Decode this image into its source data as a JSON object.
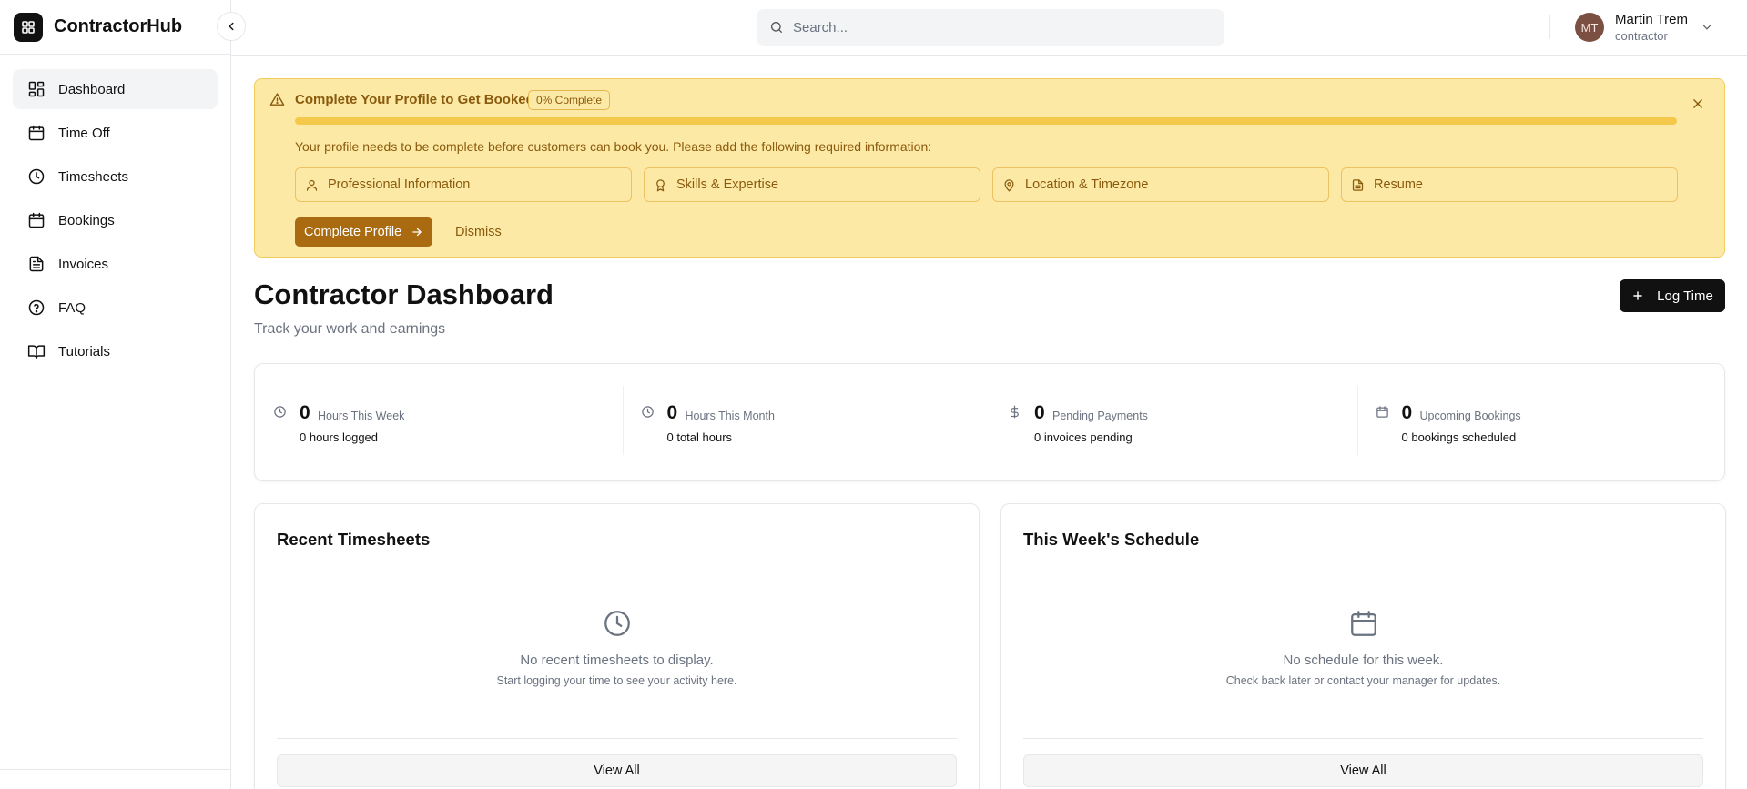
{
  "app": {
    "name": "ContractorHub"
  },
  "sidebar": {
    "items": [
      {
        "label": "Dashboard",
        "icon": "dashboard-icon",
        "active": true
      },
      {
        "label": "Time Off",
        "icon": "calendar-icon"
      },
      {
        "label": "Timesheets",
        "icon": "clock-icon"
      },
      {
        "label": "Bookings",
        "icon": "calendar-icon"
      },
      {
        "label": "Invoices",
        "icon": "file-text-icon"
      },
      {
        "label": "FAQ",
        "icon": "help-circle-icon"
      },
      {
        "label": "Tutorials",
        "icon": "book-open-icon"
      }
    ]
  },
  "header": {
    "search_placeholder": "Search...",
    "user": {
      "initials": "MT",
      "name": "Martin Trem",
      "role": "contractor"
    }
  },
  "banner": {
    "title": "Complete Your Profile to Get Booked",
    "badge": "0% Complete",
    "progress": 0,
    "message": "Your profile needs to be complete before customers can book you. Please add the following required information:",
    "requirements": [
      {
        "label": "Professional Information",
        "icon": "user-icon"
      },
      {
        "label": "Skills & Expertise",
        "icon": "award-icon"
      },
      {
        "label": "Location & Timezone",
        "icon": "map-pin-icon"
      },
      {
        "label": "Resume",
        "icon": "file-text-icon"
      }
    ],
    "primary_label": "Complete Profile",
    "dismiss_label": "Dismiss"
  },
  "page": {
    "title": "Contractor Dashboard",
    "subtitle": "Track your work and earnings",
    "log_time_label": "Log Time"
  },
  "stats": [
    {
      "value": "0",
      "label": "Hours This Week",
      "sub": "0 hours logged",
      "icon": "clock-icon"
    },
    {
      "value": "0",
      "label": "Hours This Month",
      "sub": "0 total hours",
      "icon": "clock-icon"
    },
    {
      "value": "0",
      "label": "Pending Payments",
      "sub": "0 invoices pending",
      "icon": "dollar-icon"
    },
    {
      "value": "0",
      "label": "Upcoming Bookings",
      "sub": "0 bookings scheduled",
      "icon": "calendar-icon"
    }
  ],
  "cards": {
    "timesheets": {
      "title": "Recent Timesheets",
      "empty_title": "No recent timesheets to display.",
      "empty_sub": "Start logging your time to see your activity here.",
      "view_all": "View All"
    },
    "schedule": {
      "title": "This Week's Schedule",
      "empty_title": "No schedule for this week.",
      "empty_sub": "Check back later or contact your manager for updates.",
      "view_all": "View All"
    }
  },
  "colors": {
    "banner_bg": "#fde9a6",
    "banner_text": "#8a5a0c",
    "accent_button": "#a96a10",
    "primary_button": "#111111"
  }
}
